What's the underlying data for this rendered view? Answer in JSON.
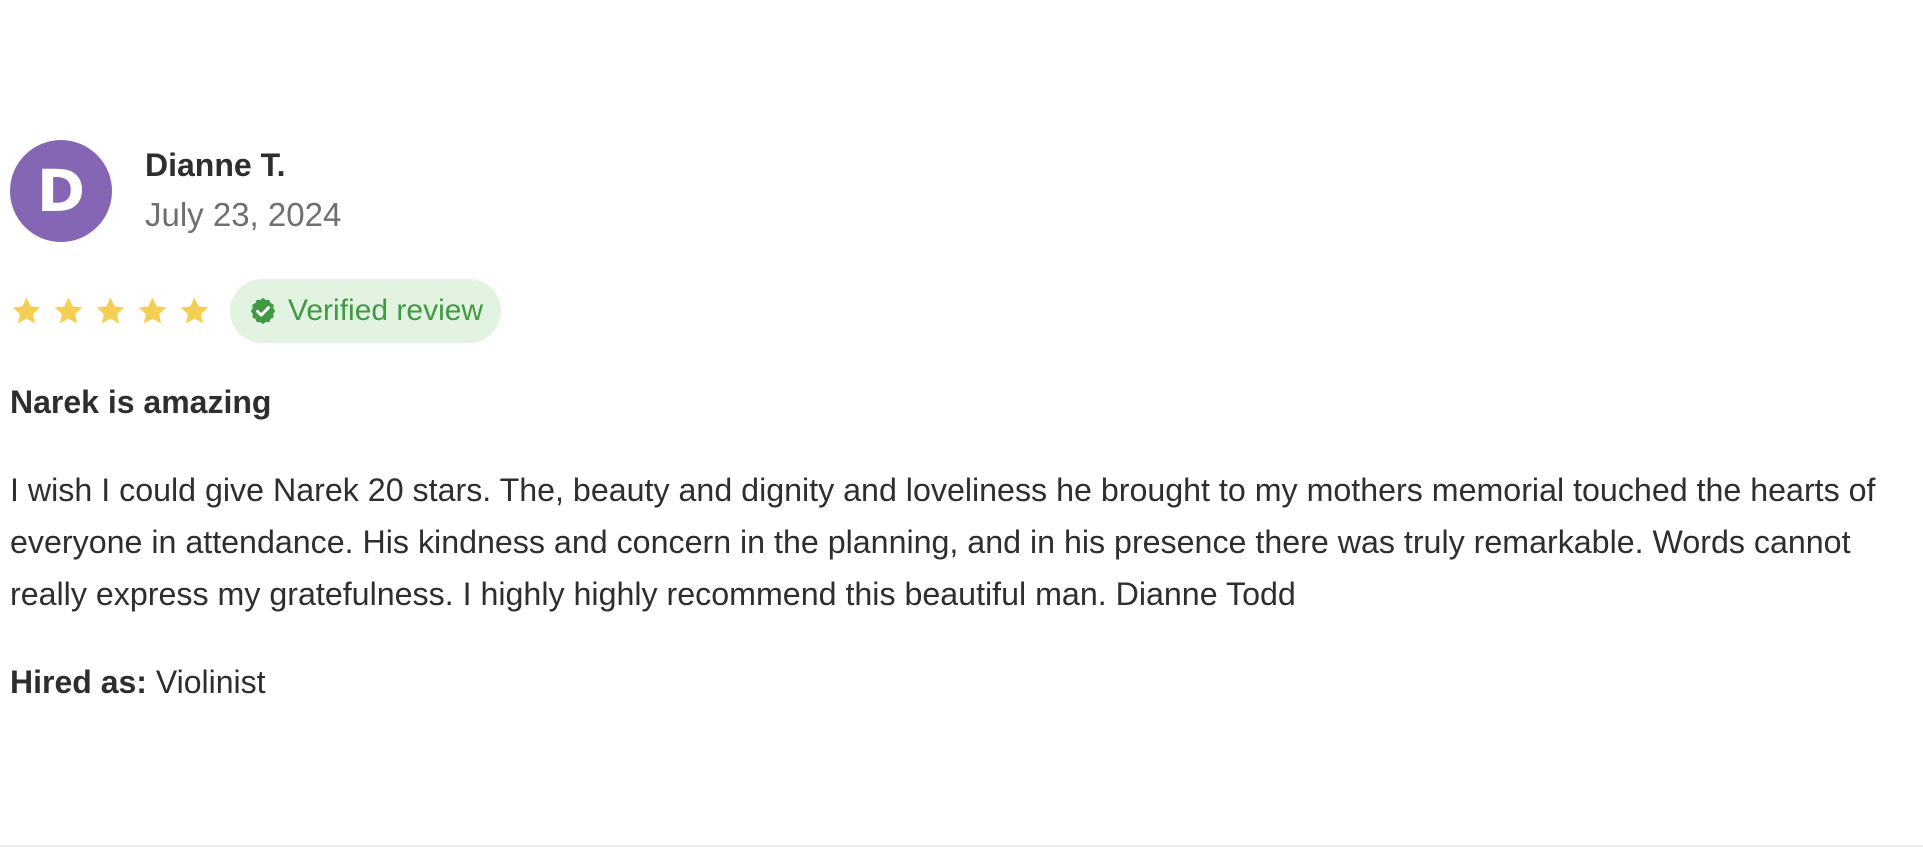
{
  "reviewer": {
    "initial": "D",
    "name": "Dianne T.",
    "date": "July 23, 2024",
    "avatar_color": "#8466b4"
  },
  "rating": {
    "stars": 5,
    "max_stars": 5,
    "star_color": "#f5cf55",
    "star_icon": "star-icon",
    "badge_icon": "check-badge-icon",
    "verified_label": "Verified review",
    "badge_bg": "#e3f3e1",
    "badge_color": "#3f9a43"
  },
  "review": {
    "title": "Narek is amazing",
    "body": "I wish I could give Narek 20 stars. The, beauty and dignity and loveliness he brought to my mothers memorial touched the hearts of everyone in attendance. His kindness and concern in the planning, and in his presence there was truly remarkable. Words cannot really express my gratefulness. I highly highly recommend this beautiful man. Dianne Todd",
    "hired_label": "Hired as:",
    "hired_value": "Violinist"
  }
}
